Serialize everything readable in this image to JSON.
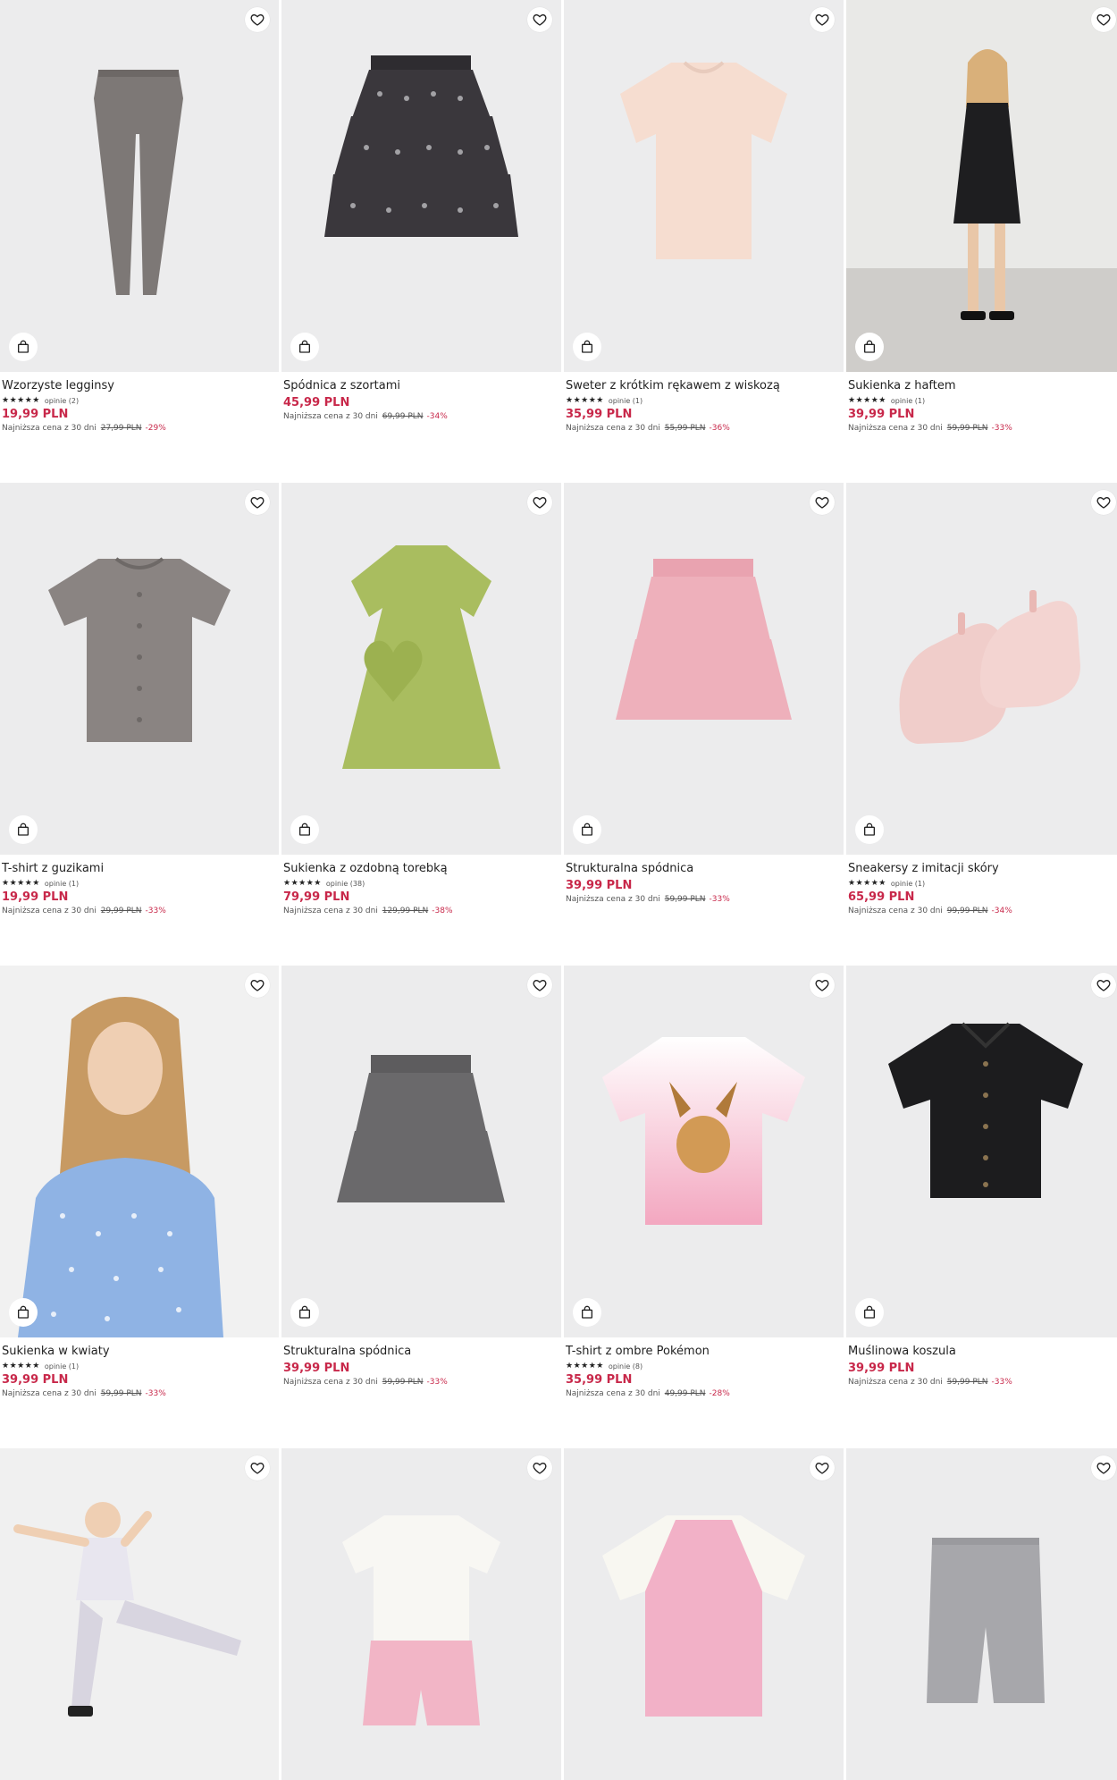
{
  "lowest_label": "Najniższa cena z 30 dni",
  "products": [
    {
      "name": "Wzorzyste legginsy",
      "stars": "★★★★★",
      "reviews": "opinie (2)",
      "price": "19,99 PLN",
      "old_price": "27,99 PLN",
      "discount": "-29%"
    },
    {
      "name": "Spódnica z szortami",
      "stars": "",
      "reviews": "",
      "price": "45,99 PLN",
      "old_price": "69,99 PLN",
      "discount": "-34%"
    },
    {
      "name": "Sweter z krótkim rękawem z wiskozą",
      "stars": "★★★★★",
      "reviews": "opinie (1)",
      "price": "35,99 PLN",
      "old_price": "55,99 PLN",
      "discount": "-36%"
    },
    {
      "name": "Sukienka z haftem",
      "stars": "★★★★★",
      "reviews": "opinie (1)",
      "price": "39,99 PLN",
      "old_price": "59,99 PLN",
      "discount": "-33%"
    },
    {
      "name": "T-shirt z guzikami",
      "stars": "★★★★★",
      "reviews": "opinie (1)",
      "price": "19,99 PLN",
      "old_price": "29,99 PLN",
      "discount": "-33%"
    },
    {
      "name": "Sukienka z ozdobną torebką",
      "stars": "★★★★★",
      "reviews": "opinie (38)",
      "price": "79,99 PLN",
      "old_price": "129,99 PLN",
      "discount": "-38%"
    },
    {
      "name": "Strukturalna spódnica",
      "stars": "",
      "reviews": "",
      "price": "39,99 PLN",
      "old_price": "59,99 PLN",
      "discount": "-33%"
    },
    {
      "name": "Sneakersy z imitacji skóry",
      "stars": "★★★★★",
      "reviews": "opinie (1)",
      "price": "65,99 PLN",
      "old_price": "99,99 PLN",
      "discount": "-34%"
    },
    {
      "name": "Sukienka w kwiaty",
      "stars": "★★★★★",
      "reviews": "opinie (1)",
      "price": "39,99 PLN",
      "old_price": "59,99 PLN",
      "discount": "-33%"
    },
    {
      "name": "Strukturalna spódnica",
      "stars": "",
      "reviews": "",
      "price": "39,99 PLN",
      "old_price": "59,99 PLN",
      "discount": "-33%"
    },
    {
      "name": "T-shirt z ombre Pokémon",
      "stars": "★★★★★",
      "reviews": "opinie (8)",
      "price": "35,99 PLN",
      "old_price": "49,99 PLN",
      "discount": "-28%"
    },
    {
      "name": "Muślinowa koszula",
      "stars": "",
      "reviews": "",
      "price": "39,99 PLN",
      "old_price": "59,99 PLN",
      "discount": "-33%"
    },
    {
      "name": "",
      "stars": "",
      "reviews": "",
      "price": "",
      "old_price": "",
      "discount": ""
    },
    {
      "name": "",
      "stars": "",
      "reviews": "",
      "price": "",
      "old_price": "",
      "discount": ""
    },
    {
      "name": "",
      "stars": "",
      "reviews": "",
      "price": "",
      "old_price": "",
      "discount": ""
    },
    {
      "name": "",
      "stars": "",
      "reviews": "",
      "price": "",
      "old_price": "",
      "discount": ""
    }
  ],
  "icons": {
    "wishlist": "heart-icon",
    "cart": "shopping-bag-icon"
  },
  "colors": {
    "price": "#c8284a",
    "image_bg": "#ececed"
  }
}
